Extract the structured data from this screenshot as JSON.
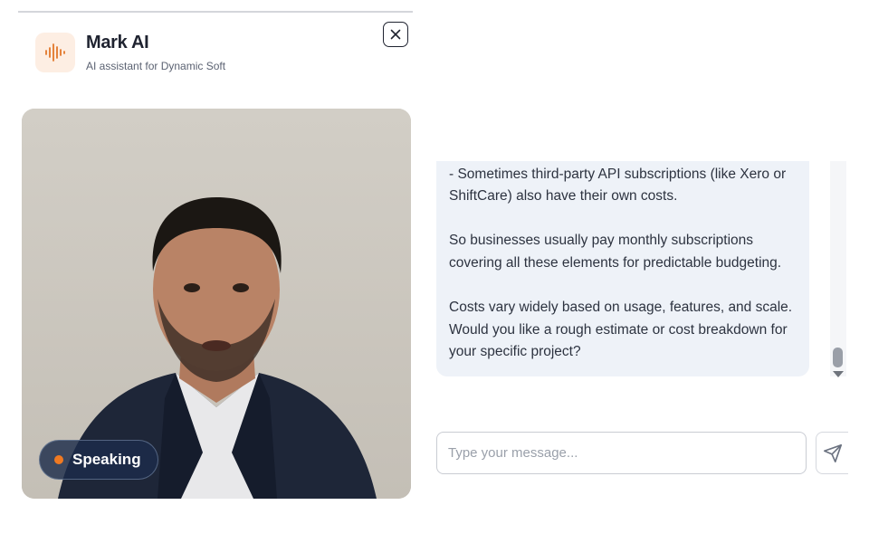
{
  "header": {
    "title": "Mark AI",
    "subtitle": "AI assistant for Dynamic Soft",
    "logo_icon": "sound-wave-icon",
    "close_icon": "close-icon"
  },
  "video": {
    "status_label": "Speaking",
    "status_color": "#f07a22"
  },
  "chat": {
    "message_lines": [
      "- Sometimes third-party API subscriptions (like Xero or ShiftCare) also have their own costs.",
      "So businesses usually pay monthly subscriptions covering all these elements for predictable budgeting.",
      "Costs vary widely based on usage, features, and scale. Would you like a rough estimate or cost breakdown for your specific project?"
    ]
  },
  "composer": {
    "placeholder": "Type your message...",
    "send_icon": "send-icon"
  },
  "colors": {
    "accent": "#f07a22",
    "bubble_bg": "#eef2f8",
    "text_dark": "#1f2330"
  }
}
